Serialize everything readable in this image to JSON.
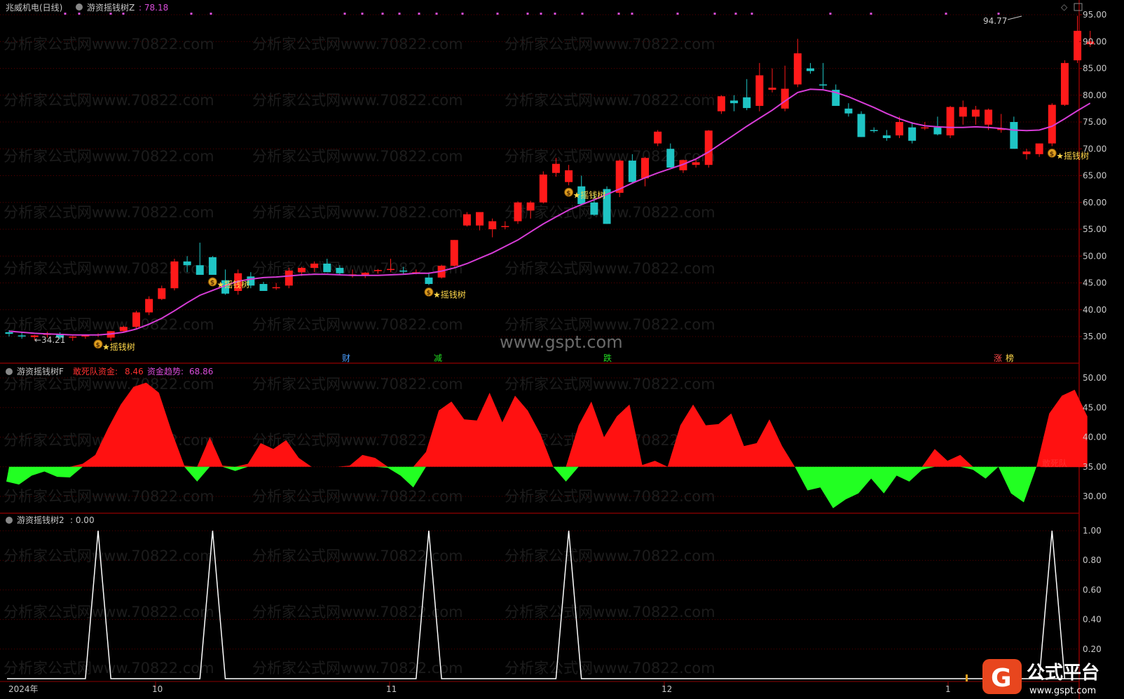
{
  "colors": {
    "up": "#ff1a1a",
    "down": "#1fc4c4",
    "ma": "#d63cd6",
    "grid": "#5a0000",
    "axis_text": "#c8c8c8",
    "title": "#c8c8c8",
    "magenta": "#d94cd9",
    "green": "#22ff22",
    "red": "#ff1111",
    "white": "#ffffff",
    "yellow": "#ffd84a"
  },
  "header": {
    "stock": "兆威机电(日线)",
    "indicator": "游资摇钱树Z",
    "value": ": 78.18"
  },
  "panel_f": {
    "name": "游资摇钱树F",
    "series1_label": "敢死队资金:",
    "series1_value": "8.46",
    "series2_label": "资金趋势:",
    "series2_value": "68.86",
    "right_label": "敢死队"
  },
  "panel_2": {
    "name": "游资摇钱树2",
    "value": ": 0.00"
  },
  "main_axis": [
    "95.00",
    "90.00",
    "85.00",
    "80.00",
    "75.00",
    "70.00",
    "65.00",
    "60.00",
    "55.00",
    "50.00",
    "45.00",
    "40.00",
    "35.00"
  ],
  "f_axis": [
    "50.00",
    "45.00",
    "40.00",
    "35.00",
    "30.00"
  ],
  "p2_axis": [
    "1.00",
    "0.80",
    "0.60",
    "0.40",
    "0.20"
  ],
  "markers": {
    "high_label": "94.77",
    "low_label": "←34.21",
    "signal_text": "★摇钱树",
    "coin": "$"
  },
  "bottom_events": [
    "财",
    "减",
    "跌",
    "涨",
    "榜"
  ],
  "x_axis": [
    "2024年",
    "10",
    "11",
    "12",
    "1"
  ],
  "watermark": "分析家公式网www.70822.com",
  "center_watermark": "www.gspt.com",
  "logo": {
    "title": "公式平台",
    "url": "www.gspt.com"
  },
  "chart_data": {
    "type": "candlestick",
    "ylim": [
      31,
      97
    ],
    "candles": [
      [
        35.8,
        36.2,
        35.0,
        35.5
      ],
      [
        35.2,
        35.8,
        34.6,
        35.0
      ],
      [
        34.9,
        35.3,
        34.3,
        35.2
      ],
      [
        35.3,
        35.9,
        34.8,
        35.6
      ],
      [
        35.5,
        35.8,
        34.5,
        34.8
      ],
      [
        34.8,
        35.1,
        34.2,
        35.0
      ],
      [
        35.0,
        35.4,
        34.6,
        35.2
      ],
      [
        35.2,
        35.6,
        34.9,
        35.4
      ],
      [
        34.8,
        36.0,
        34.2,
        36.0
      ],
      [
        36.0,
        37.0,
        35.8,
        36.8
      ],
      [
        36.8,
        39.8,
        36.5,
        39.5
      ],
      [
        39.5,
        42.5,
        39.0,
        42.0
      ],
      [
        42.0,
        44.5,
        41.8,
        44.0
      ],
      [
        44.0,
        49.5,
        43.6,
        49.0
      ],
      [
        49.0,
        50.0,
        47.0,
        48.3
      ],
      [
        48.3,
        52.5,
        46.5,
        46.5
      ],
      [
        49.8,
        50.0,
        46.5,
        46.5
      ],
      [
        45.5,
        47.5,
        42.8,
        43.0
      ],
      [
        43.5,
        47.5,
        42.8,
        46.8
      ],
      [
        46.2,
        47.0,
        44.0,
        44.5
      ],
      [
        44.8,
        45.2,
        43.5,
        43.5
      ],
      [
        44.0,
        45.0,
        43.7,
        44.2
      ],
      [
        44.5,
        47.8,
        44.0,
        47.3
      ],
      [
        47.0,
        48.0,
        46.3,
        47.8
      ],
      [
        47.8,
        49.0,
        47.0,
        48.6
      ],
      [
        48.6,
        49.5,
        47.0,
        47.0
      ],
      [
        47.8,
        48.3,
        46.5,
        46.8
      ],
      [
        46.5,
        47.5,
        46.0,
        46.6
      ],
      [
        46.4,
        47.0,
        45.9,
        46.9
      ],
      [
        47.2,
        47.6,
        46.7,
        47.4
      ],
      [
        47.5,
        49.5,
        47.0,
        47.6
      ],
      [
        47.3,
        48.0,
        46.7,
        47.2
      ],
      [
        47.0,
        47.5,
        46.6,
        47.0
      ],
      [
        46.0,
        46.7,
        44.6,
        44.8
      ],
      [
        46.0,
        48.4,
        45.8,
        48.2
      ],
      [
        48.2,
        53.0,
        48.0,
        53.0
      ],
      [
        55.7,
        58.2,
        55.5,
        57.8
      ],
      [
        55.7,
        58.2,
        54.8,
        58.2
      ],
      [
        55.0,
        57.0,
        53.5,
        56.5
      ],
      [
        55.5,
        56.5,
        55.0,
        55.6
      ],
      [
        56.5,
        60.2,
        56.0,
        60.0
      ],
      [
        58.5,
        60.3,
        57.0,
        60.0
      ],
      [
        60.0,
        65.8,
        59.8,
        65.2
      ],
      [
        65.5,
        68.3,
        64.8,
        67.2
      ],
      [
        63.8,
        67.0,
        63.2,
        66.0
      ],
      [
        63.0,
        65.0,
        59.7,
        59.7
      ],
      [
        60.0,
        62.0,
        57.5,
        57.7
      ],
      [
        62.5,
        63.0,
        56.0,
        56.0
      ],
      [
        61.8,
        68.0,
        61.0,
        67.8
      ],
      [
        67.8,
        69.0,
        63.5,
        63.8
      ],
      [
        64.5,
        68.5,
        63.0,
        68.3
      ],
      [
        71.0,
        73.5,
        70.5,
        73.2
      ],
      [
        70.0,
        71.0,
        66.5,
        66.5
      ],
      [
        66.0,
        68.0,
        65.5,
        67.9
      ],
      [
        67.0,
        68.0,
        66.5,
        67.5
      ],
      [
        67.0,
        73.5,
        66.5,
        73.4
      ],
      [
        77.0,
        80.0,
        76.5,
        79.8
      ],
      [
        79.0,
        80.0,
        77.0,
        78.5
      ],
      [
        79.6,
        83.0,
        77.2,
        77.6
      ],
      [
        78.0,
        86.0,
        77.0,
        83.7
      ],
      [
        81.0,
        85.0,
        80.5,
        81.4
      ],
      [
        77.5,
        85.5,
        77.0,
        81.2
      ],
      [
        82.0,
        90.5,
        81.5,
        87.8
      ],
      [
        85.0,
        86.0,
        84.0,
        84.5
      ],
      [
        82.0,
        86.0,
        81.0,
        81.8
      ],
      [
        81.0,
        82.0,
        78.0,
        78.0
      ],
      [
        77.5,
        78.5,
        76.0,
        76.6
      ],
      [
        76.5,
        77.0,
        72.2,
        72.2
      ],
      [
        73.5,
        74.0,
        73.0,
        73.3
      ],
      [
        72.5,
        73.5,
        71.5,
        72.0
      ],
      [
        72.5,
        76.0,
        72.0,
        75.0
      ],
      [
        74.0,
        75.0,
        71.0,
        71.5
      ],
      [
        74.0,
        75.0,
        73.5,
        74.0
      ],
      [
        74.0,
        76.0,
        72.5,
        72.7
      ],
      [
        72.5,
        78.0,
        72.0,
        77.8
      ],
      [
        76.0,
        79.0,
        74.5,
        77.8
      ],
      [
        76.0,
        78.0,
        74.5,
        77.3
      ],
      [
        74.5,
        77.5,
        73.5,
        77.3
      ],
      [
        73.5,
        76.5,
        73.0,
        73.8
      ],
      [
        75.0,
        76.0,
        70.0,
        70.0
      ],
      [
        69.0,
        70.0,
        68.0,
        69.5
      ],
      [
        69.0,
        71.0,
        68.5,
        71.0
      ],
      [
        71.0,
        78.5,
        70.5,
        78.2
      ],
      [
        78.2,
        86.5,
        78.0,
        86.0
      ],
      [
        86.5,
        94.8,
        86.0,
        92.0
      ],
      [
        89.5,
        92.0,
        89.0,
        90.0
      ]
    ],
    "ma": [
      36.0,
      35.8,
      35.6,
      35.5,
      35.4,
      35.3,
      35.3,
      35.3,
      35.5,
      35.8,
      36.4,
      37.3,
      38.4,
      39.8,
      41.3,
      42.7,
      43.6,
      44.5,
      45.3,
      45.7,
      46.0,
      46.1,
      46.3,
      46.5,
      46.6,
      46.6,
      46.5,
      46.4,
      46.4,
      46.4,
      46.5,
      46.6,
      46.8,
      46.8,
      47.2,
      47.8,
      48.6,
      49.6,
      50.6,
      51.8,
      53.0,
      54.5,
      56.0,
      57.3,
      58.6,
      59.6,
      60.5,
      61.5,
      62.5,
      63.6,
      64.6,
      65.5,
      66.3,
      67.1,
      68.1,
      69.4,
      71.0,
      72.6,
      74.2,
      75.7,
      77.2,
      78.9,
      80.5,
      81.1,
      81.0,
      80.5,
      79.7,
      78.7,
      77.7,
      76.6,
      75.6,
      74.8,
      74.3,
      74.1,
      74.0,
      74.0,
      74.1,
      74.0,
      73.8,
      73.5,
      73.4,
      73.5,
      74.2,
      75.6,
      77.1,
      78.5
    ],
    "signals": [
      7,
      16,
      33,
      44,
      82
    ],
    "f_ylim": [
      27,
      51.5
    ],
    "f_fund": [
      32.5,
      32.0,
      33.5,
      34.2,
      33.3,
      33.2,
      35.5,
      37.0,
      41.5,
      45.5,
      48.5,
      49.2,
      47.5,
      41.0,
      35.2,
      32.5,
      40.0,
      35.2,
      34.3,
      35.5,
      39.0,
      38.0,
      39.5,
      36.5,
      35.0,
      35.0,
      35.0,
      35.2,
      37.0,
      36.5,
      34.8,
      33.5,
      31.5,
      37.5,
      44.5,
      46.0,
      43.0,
      42.8,
      47.5,
      42.5,
      47.0,
      44.5,
      40.5,
      35.0,
      32.5,
      42.0,
      46.0,
      40.0,
      43.5,
      45.5,
      35.3,
      36.0,
      35.0,
      42.0,
      45.5,
      42.0,
      42.2,
      44.0,
      38.5,
      39.0,
      43.0,
      38.5,
      35.0,
      31.0,
      31.5,
      28.0,
      29.5,
      30.5,
      33.0,
      30.5,
      33.5,
      32.5,
      34.5,
      38.0,
      36.0,
      37.0,
      34.5,
      33.0,
      35.0,
      30.5,
      29.0,
      35.0,
      44.0,
      47.0,
      48.0,
      43.5
    ],
    "p2_ylim": [
      0,
      1
    ],
    "p2_values": [
      0,
      0,
      0,
      0,
      0,
      0,
      0,
      1,
      0,
      0,
      0,
      0,
      0,
      0,
      0,
      0,
      1,
      0,
      0,
      0,
      0,
      0,
      0,
      0,
      0,
      0,
      0,
      0,
      0,
      0,
      0,
      0,
      0,
      1,
      0,
      0,
      0,
      0,
      0,
      0,
      0,
      0,
      0,
      0,
      1,
      0,
      0,
      0,
      0,
      0,
      0,
      0,
      0,
      0,
      0,
      0,
      0,
      0,
      0,
      0,
      0,
      0,
      0,
      0,
      0,
      0,
      0,
      0,
      0,
      0,
      0,
      0,
      0,
      0,
      0,
      0,
      0,
      0,
      0,
      0,
      0,
      0,
      1,
      0,
      0,
      0
    ]
  }
}
